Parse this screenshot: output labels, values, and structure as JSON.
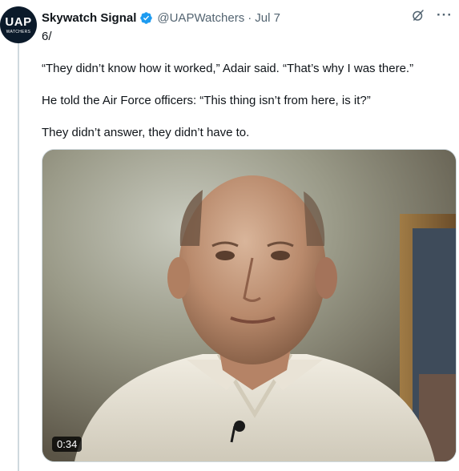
{
  "avatar": {
    "line1": "UAP",
    "line2": "WATCHERS"
  },
  "author": {
    "display_name": "Skywatch Signal",
    "handle": "@UAPWatchers",
    "separator": "·",
    "date": "Jul 7",
    "verified": true
  },
  "icons": {
    "verified": "verified-badge-icon",
    "grok": "grok-icon",
    "more": "more-icon"
  },
  "more_label": "···",
  "tweet": {
    "thread_number": "6/",
    "paragraphs": [
      "“They didn’t know how it worked,” Adair said. “That’s why I was there.”",
      "He told the Air Force officers: “This thing isn’t from here, is it?”",
      "They didn’t answer, they didn’t have to."
    ]
  },
  "media": {
    "type": "video",
    "duration": "0:34"
  },
  "colors": {
    "verified": "#1d9bf0",
    "secondary_text": "#536471",
    "primary_text": "#0f1419"
  }
}
